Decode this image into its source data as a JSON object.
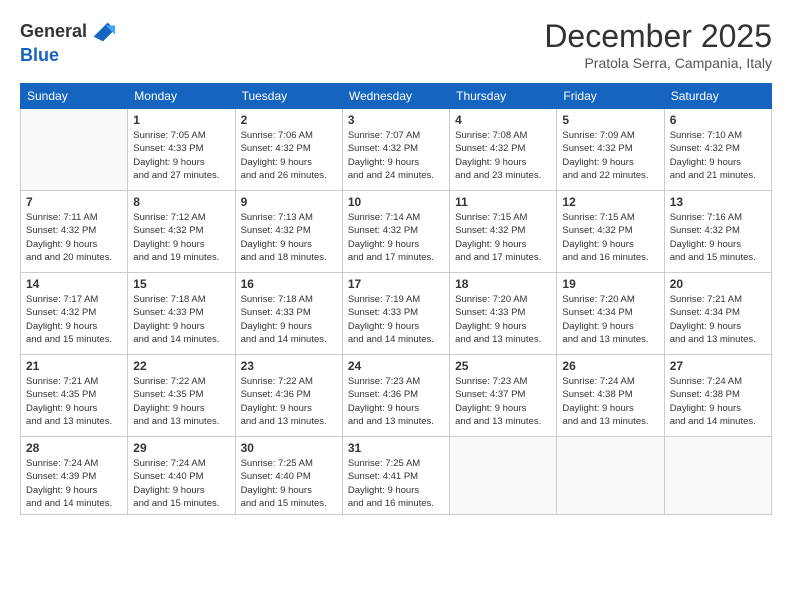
{
  "logo": {
    "general": "General",
    "blue": "Blue"
  },
  "header": {
    "month": "December 2025",
    "location": "Pratola Serra, Campania, Italy"
  },
  "weekdays": [
    "Sunday",
    "Monday",
    "Tuesday",
    "Wednesday",
    "Thursday",
    "Friday",
    "Saturday"
  ],
  "weeks": [
    [
      {
        "day": "",
        "sunrise": "",
        "sunset": "",
        "daylight": ""
      },
      {
        "day": "1",
        "sunrise": "Sunrise: 7:05 AM",
        "sunset": "Sunset: 4:33 PM",
        "daylight": "Daylight: 9 hours and 27 minutes."
      },
      {
        "day": "2",
        "sunrise": "Sunrise: 7:06 AM",
        "sunset": "Sunset: 4:32 PM",
        "daylight": "Daylight: 9 hours and 26 minutes."
      },
      {
        "day": "3",
        "sunrise": "Sunrise: 7:07 AM",
        "sunset": "Sunset: 4:32 PM",
        "daylight": "Daylight: 9 hours and 24 minutes."
      },
      {
        "day": "4",
        "sunrise": "Sunrise: 7:08 AM",
        "sunset": "Sunset: 4:32 PM",
        "daylight": "Daylight: 9 hours and 23 minutes."
      },
      {
        "day": "5",
        "sunrise": "Sunrise: 7:09 AM",
        "sunset": "Sunset: 4:32 PM",
        "daylight": "Daylight: 9 hours and 22 minutes."
      },
      {
        "day": "6",
        "sunrise": "Sunrise: 7:10 AM",
        "sunset": "Sunset: 4:32 PM",
        "daylight": "Daylight: 9 hours and 21 minutes."
      }
    ],
    [
      {
        "day": "7",
        "sunrise": "Sunrise: 7:11 AM",
        "sunset": "Sunset: 4:32 PM",
        "daylight": "Daylight: 9 hours and 20 minutes."
      },
      {
        "day": "8",
        "sunrise": "Sunrise: 7:12 AM",
        "sunset": "Sunset: 4:32 PM",
        "daylight": "Daylight: 9 hours and 19 minutes."
      },
      {
        "day": "9",
        "sunrise": "Sunrise: 7:13 AM",
        "sunset": "Sunset: 4:32 PM",
        "daylight": "Daylight: 9 hours and 18 minutes."
      },
      {
        "day": "10",
        "sunrise": "Sunrise: 7:14 AM",
        "sunset": "Sunset: 4:32 PM",
        "daylight": "Daylight: 9 hours and 17 minutes."
      },
      {
        "day": "11",
        "sunrise": "Sunrise: 7:15 AM",
        "sunset": "Sunset: 4:32 PM",
        "daylight": "Daylight: 9 hours and 17 minutes."
      },
      {
        "day": "12",
        "sunrise": "Sunrise: 7:15 AM",
        "sunset": "Sunset: 4:32 PM",
        "daylight": "Daylight: 9 hours and 16 minutes."
      },
      {
        "day": "13",
        "sunrise": "Sunrise: 7:16 AM",
        "sunset": "Sunset: 4:32 PM",
        "daylight": "Daylight: 9 hours and 15 minutes."
      }
    ],
    [
      {
        "day": "14",
        "sunrise": "Sunrise: 7:17 AM",
        "sunset": "Sunset: 4:32 PM",
        "daylight": "Daylight: 9 hours and 15 minutes."
      },
      {
        "day": "15",
        "sunrise": "Sunrise: 7:18 AM",
        "sunset": "Sunset: 4:33 PM",
        "daylight": "Daylight: 9 hours and 14 minutes."
      },
      {
        "day": "16",
        "sunrise": "Sunrise: 7:18 AM",
        "sunset": "Sunset: 4:33 PM",
        "daylight": "Daylight: 9 hours and 14 minutes."
      },
      {
        "day": "17",
        "sunrise": "Sunrise: 7:19 AM",
        "sunset": "Sunset: 4:33 PM",
        "daylight": "Daylight: 9 hours and 14 minutes."
      },
      {
        "day": "18",
        "sunrise": "Sunrise: 7:20 AM",
        "sunset": "Sunset: 4:33 PM",
        "daylight": "Daylight: 9 hours and 13 minutes."
      },
      {
        "day": "19",
        "sunrise": "Sunrise: 7:20 AM",
        "sunset": "Sunset: 4:34 PM",
        "daylight": "Daylight: 9 hours and 13 minutes."
      },
      {
        "day": "20",
        "sunrise": "Sunrise: 7:21 AM",
        "sunset": "Sunset: 4:34 PM",
        "daylight": "Daylight: 9 hours and 13 minutes."
      }
    ],
    [
      {
        "day": "21",
        "sunrise": "Sunrise: 7:21 AM",
        "sunset": "Sunset: 4:35 PM",
        "daylight": "Daylight: 9 hours and 13 minutes."
      },
      {
        "day": "22",
        "sunrise": "Sunrise: 7:22 AM",
        "sunset": "Sunset: 4:35 PM",
        "daylight": "Daylight: 9 hours and 13 minutes."
      },
      {
        "day": "23",
        "sunrise": "Sunrise: 7:22 AM",
        "sunset": "Sunset: 4:36 PM",
        "daylight": "Daylight: 9 hours and 13 minutes."
      },
      {
        "day": "24",
        "sunrise": "Sunrise: 7:23 AM",
        "sunset": "Sunset: 4:36 PM",
        "daylight": "Daylight: 9 hours and 13 minutes."
      },
      {
        "day": "25",
        "sunrise": "Sunrise: 7:23 AM",
        "sunset": "Sunset: 4:37 PM",
        "daylight": "Daylight: 9 hours and 13 minutes."
      },
      {
        "day": "26",
        "sunrise": "Sunrise: 7:24 AM",
        "sunset": "Sunset: 4:38 PM",
        "daylight": "Daylight: 9 hours and 13 minutes."
      },
      {
        "day": "27",
        "sunrise": "Sunrise: 7:24 AM",
        "sunset": "Sunset: 4:38 PM",
        "daylight": "Daylight: 9 hours and 14 minutes."
      }
    ],
    [
      {
        "day": "28",
        "sunrise": "Sunrise: 7:24 AM",
        "sunset": "Sunset: 4:39 PM",
        "daylight": "Daylight: 9 hours and 14 minutes."
      },
      {
        "day": "29",
        "sunrise": "Sunrise: 7:24 AM",
        "sunset": "Sunset: 4:40 PM",
        "daylight": "Daylight: 9 hours and 15 minutes."
      },
      {
        "day": "30",
        "sunrise": "Sunrise: 7:25 AM",
        "sunset": "Sunset: 4:40 PM",
        "daylight": "Daylight: 9 hours and 15 minutes."
      },
      {
        "day": "31",
        "sunrise": "Sunrise: 7:25 AM",
        "sunset": "Sunset: 4:41 PM",
        "daylight": "Daylight: 9 hours and 16 minutes."
      },
      {
        "day": "",
        "sunrise": "",
        "sunset": "",
        "daylight": ""
      },
      {
        "day": "",
        "sunrise": "",
        "sunset": "",
        "daylight": ""
      },
      {
        "day": "",
        "sunrise": "",
        "sunset": "",
        "daylight": ""
      }
    ]
  ]
}
